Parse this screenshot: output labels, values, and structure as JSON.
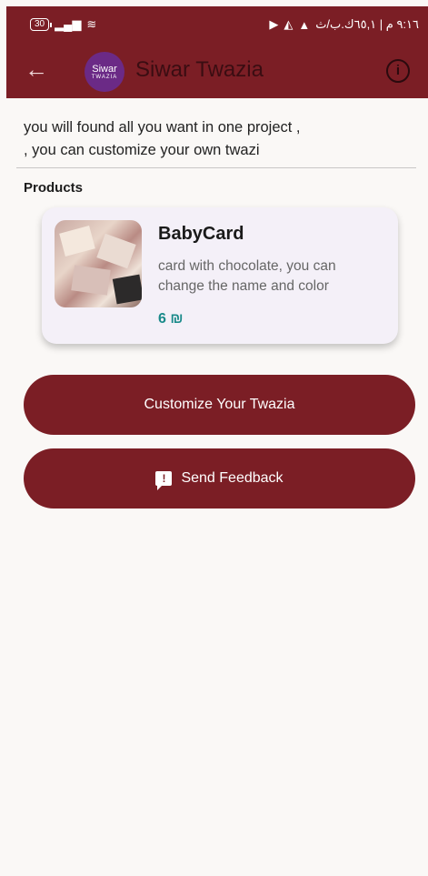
{
  "status_bar": {
    "battery": "30",
    "right_text": "٩:١٦ م | ٦٥,١ك.ب/ث"
  },
  "app_bar": {
    "title": "Siwar Twazia",
    "logo_text": "Siwar",
    "logo_subtext": "TWAZIA"
  },
  "description": {
    "line1": "you will found all you want in one project ,",
    "line2": ", you can customize your own twazi"
  },
  "section_title": "Products",
  "product": {
    "name": "BabyCard",
    "description": "card with chocolate, you can change the name and color",
    "price": "6 ₪"
  },
  "buttons": {
    "customize": "Customize Your Twazia",
    "feedback": "Send Feedback"
  },
  "colors": {
    "primary": "#7b1e25",
    "price": "#1a8a8a",
    "background": "#faf8f6",
    "card": "#f4f0f8"
  }
}
